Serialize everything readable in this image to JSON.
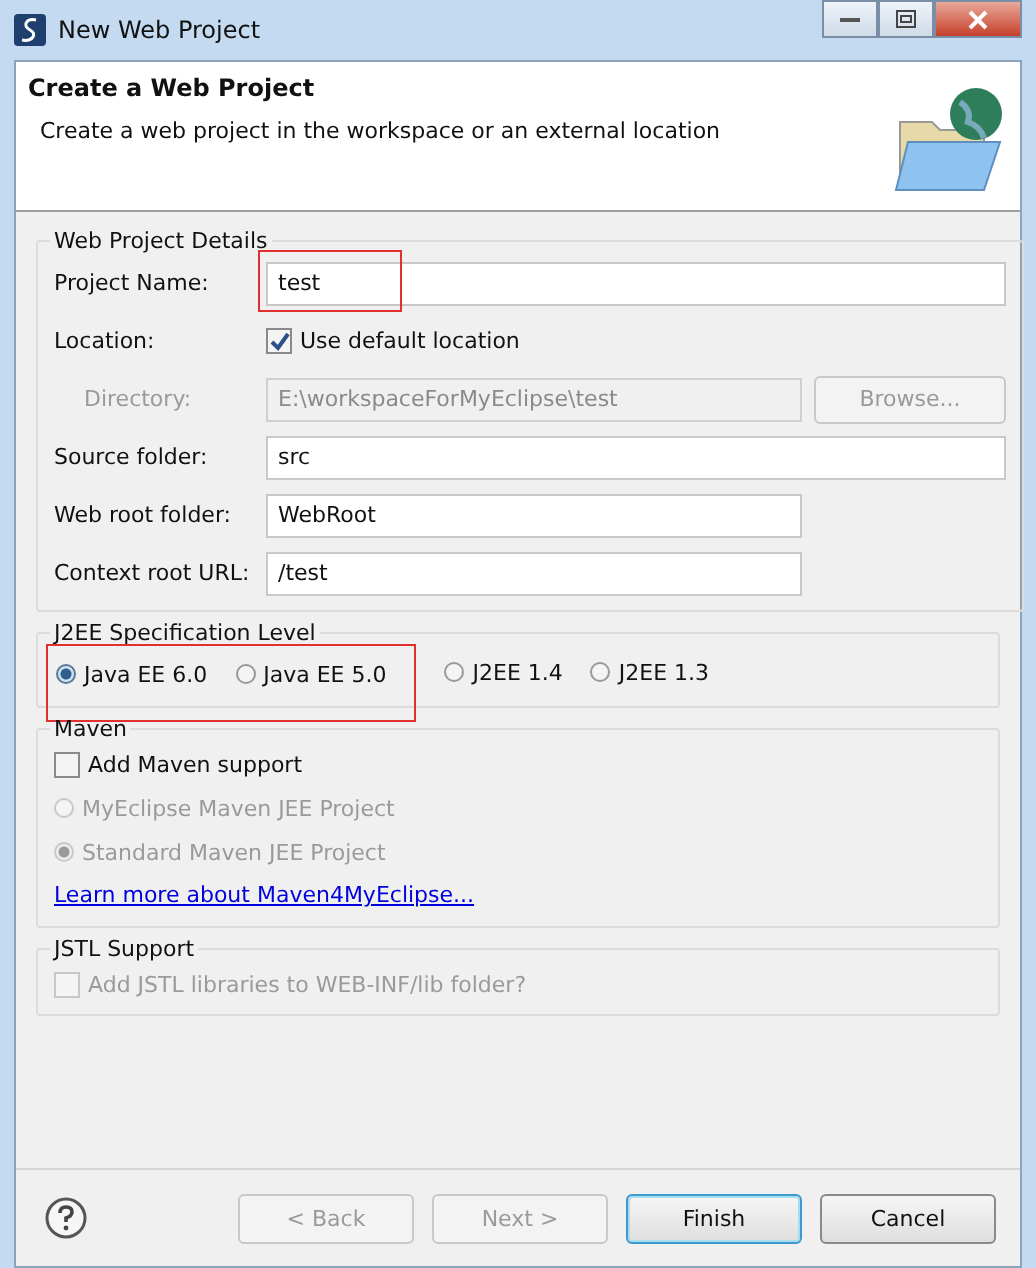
{
  "window": {
    "title": "New Web Project"
  },
  "header": {
    "title": "Create a Web Project",
    "description": "Create a web project in the workspace or an external location"
  },
  "details": {
    "legend": "Web Project Details",
    "project_name": {
      "label": "Project Name:",
      "value": "test",
      "highlighted": true
    },
    "location": {
      "label": "Location:",
      "checkbox_label": "Use default location",
      "checked": true
    },
    "directory": {
      "label": "Directory:",
      "value": "E:\\workspaceForMyEclipse\\test",
      "disabled": true,
      "button": "Browse..."
    },
    "source_folder": {
      "label": "Source folder:",
      "value": "src"
    },
    "web_root_folder": {
      "label": "Web root folder:",
      "value": "WebRoot"
    },
    "context_root_url": {
      "label": "Context root URL:",
      "value": "/test"
    }
  },
  "spec_level": {
    "legend": "J2EE Specification Level",
    "options": [
      {
        "label": "Java EE 6.0",
        "selected": true,
        "highlighted": true
      },
      {
        "label": "Java EE 5.0",
        "selected": false,
        "highlighted": true
      },
      {
        "label": "J2EE 1.4",
        "selected": false,
        "highlighted": false
      },
      {
        "label": "J2EE 1.3",
        "selected": false,
        "highlighted": false
      }
    ]
  },
  "maven": {
    "legend": "Maven",
    "add_support": {
      "label": "Add Maven support",
      "checked": false
    },
    "options": [
      {
        "label": "MyEclipse Maven JEE Project",
        "selected": false,
        "disabled": true
      },
      {
        "label": "Standard Maven JEE Project",
        "selected": true,
        "disabled": true
      }
    ],
    "link": "Learn more about Maven4MyEclipse..."
  },
  "jstl": {
    "legend": "JSTL Support",
    "checkbox": {
      "label": "Add JSTL libraries to WEB-INF/lib folder?",
      "checked": false,
      "disabled": true
    }
  },
  "buttons": [
    {
      "label": "< Back",
      "disabled": true,
      "default": false
    },
    {
      "label": "Next >",
      "disabled": true,
      "default": false
    },
    {
      "label": "Finish",
      "disabled": false,
      "default": true
    },
    {
      "label": "Cancel",
      "disabled": false,
      "default": false
    }
  ]
}
